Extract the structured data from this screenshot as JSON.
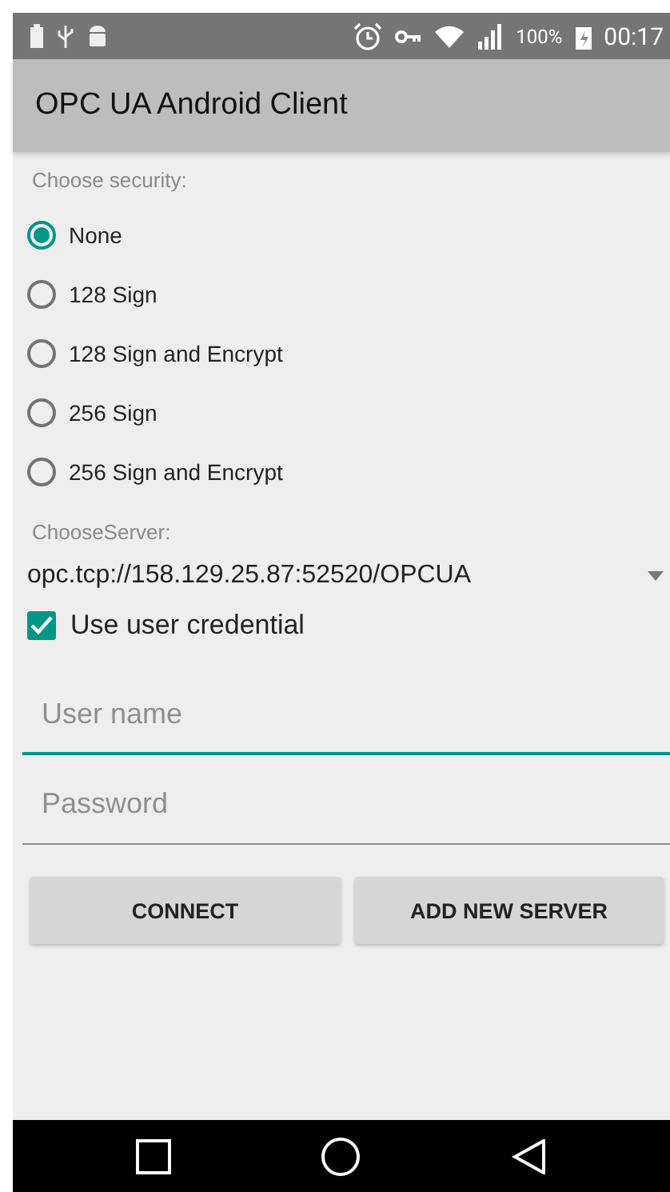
{
  "status_bar": {
    "battery_percent": "100%",
    "time": "00:17"
  },
  "app_bar": {
    "title": "OPC UA Android Client"
  },
  "security": {
    "label": "Choose security:",
    "options": [
      {
        "label": "None",
        "selected": true
      },
      {
        "label": "128 Sign",
        "selected": false
      },
      {
        "label": "128 Sign and Encrypt",
        "selected": false
      },
      {
        "label": "256 Sign",
        "selected": false
      },
      {
        "label": "256 Sign and Encrypt",
        "selected": false
      }
    ]
  },
  "server": {
    "label": "ChooseServer:",
    "value": "opc.tcp://158.129.25.87:52520/OPCUA"
  },
  "credential": {
    "label": "Use user credential",
    "checked": true
  },
  "fields": [
    {
      "placeholder": "User name",
      "focused": true
    },
    {
      "placeholder": "Password",
      "focused": false
    }
  ],
  "buttons": [
    "CONNECT",
    "ADD NEW SERVER"
  ]
}
